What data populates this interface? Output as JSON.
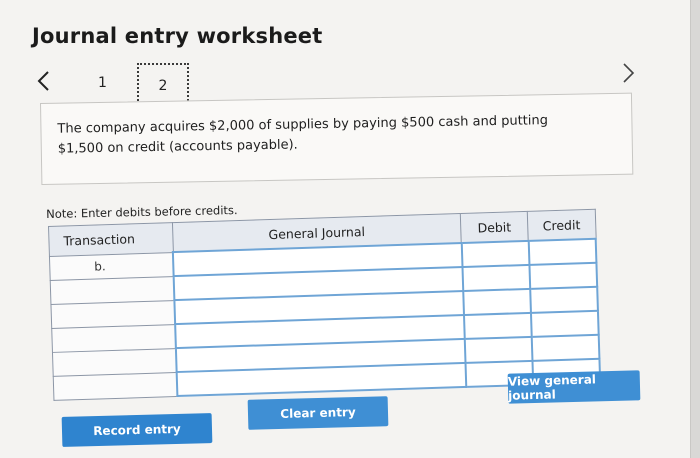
{
  "header": {
    "title": "Journal entry worksheet"
  },
  "pagination": {
    "prev_icon": "chevron-left-icon",
    "next_icon": "chevron-right-icon",
    "pages": [
      "1",
      "2"
    ],
    "current_page": "2"
  },
  "problem": {
    "text": "The company acquires $2,000 of supplies by paying $500 cash and putting $1,500 on credit (accounts payable)."
  },
  "note": "Note: Enter debits before credits.",
  "journal": {
    "columns": [
      "Transaction",
      "General Journal",
      "Debit",
      "Credit"
    ],
    "rows": [
      {
        "transaction": "b.",
        "account": "",
        "debit": "",
        "credit": ""
      },
      {
        "transaction": "",
        "account": "",
        "debit": "",
        "credit": ""
      },
      {
        "transaction": "",
        "account": "",
        "debit": "",
        "credit": ""
      },
      {
        "transaction": "",
        "account": "",
        "debit": "",
        "credit": ""
      },
      {
        "transaction": "",
        "account": "",
        "debit": "",
        "credit": ""
      },
      {
        "transaction": "",
        "account": "",
        "debit": "",
        "credit": ""
      }
    ]
  },
  "buttons": {
    "record": "Record entry",
    "clear": "Clear entry",
    "view": "View general journal"
  },
  "colors": {
    "button": "#3f8fd4",
    "header_bg": "#e6eaf0",
    "input_border": "#6fa5d6"
  }
}
